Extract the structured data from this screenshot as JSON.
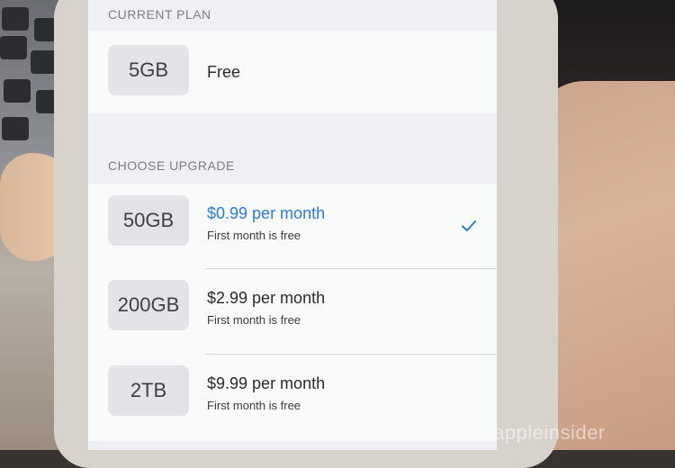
{
  "current_plan": {
    "header": "CURRENT PLAN",
    "size": "5GB",
    "label": "Free"
  },
  "choose_upgrade": {
    "header": "CHOOSE UPGRADE",
    "options": [
      {
        "size": "50GB",
        "price": "$0.99 per month",
        "note": "First month is free",
        "selected": true
      },
      {
        "size": "200GB",
        "price": "$2.99 per month",
        "note": "First month is free",
        "selected": false
      },
      {
        "size": "2TB",
        "price": "$9.99 per month",
        "note": "First month is free",
        "selected": false
      }
    ]
  },
  "watermark": "appleinsider",
  "colors": {
    "accent": "#2d7be0",
    "group_bg": "#f9fafa",
    "screen_bg": "#eff0f4"
  }
}
